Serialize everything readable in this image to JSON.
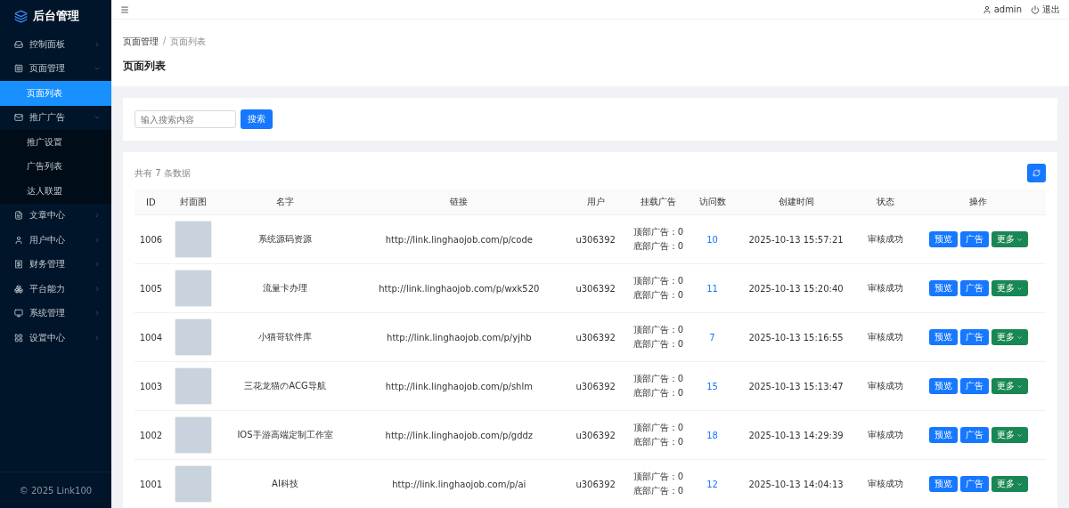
{
  "brand": {
    "title": "后台管理"
  },
  "sidebar": {
    "items": [
      {
        "label": "控制面板",
        "expanded": false
      },
      {
        "label": "页面管理",
        "expanded": true,
        "children": [
          {
            "label": "页面列表",
            "selected": true
          }
        ]
      },
      {
        "label": "推广广告",
        "expanded": true,
        "children": [
          {
            "label": "推广设置",
            "selected": false
          },
          {
            "label": "广告列表",
            "selected": false
          },
          {
            "label": "达人联盟",
            "selected": false
          }
        ]
      },
      {
        "label": "文章中心",
        "expanded": false
      },
      {
        "label": "用户中心",
        "expanded": false
      },
      {
        "label": "财务管理",
        "expanded": false
      },
      {
        "label": "平台能力",
        "expanded": false
      },
      {
        "label": "系统管理",
        "expanded": false
      },
      {
        "label": "设置中心",
        "expanded": false
      }
    ],
    "footer": "© 2025 Link100"
  },
  "topbar": {
    "user": "admin",
    "logout": "退出"
  },
  "breadcrumb": [
    "页面管理",
    "页面列表"
  ],
  "breadcrumb_separator": "/",
  "page_title": "页面列表",
  "search": {
    "placeholder": "输入搜索内容",
    "button": "搜索"
  },
  "table": {
    "summary": "共有 7 条数据",
    "columns": [
      "ID",
      "封面图",
      "名字",
      "链接",
      "用户",
      "挂载广告",
      "访问数",
      "创建时间",
      "状态",
      "操作"
    ],
    "rows": [
      {
        "id": "1006",
        "name": "系统源码资源",
        "link": "http://link.linghaojob.com/p/code",
        "user": "u306392",
        "ads": [
          "顶部广告：0",
          "底部广告：0"
        ],
        "visits": "10",
        "created": "2025-10-13 15:57:21",
        "status": "审核成功",
        "actions": [
          "预览",
          "广告",
          "更多"
        ]
      },
      {
        "id": "1005",
        "name": "流量卡办理",
        "link": "http://link.linghaojob.com/p/wxk520",
        "user": "u306392",
        "ads": [
          "顶部广告：0",
          "底部广告：0"
        ],
        "visits": "11",
        "created": "2025-10-13 15:20:40",
        "status": "审核成功",
        "actions": [
          "预览",
          "广告",
          "更多"
        ]
      },
      {
        "id": "1004",
        "name": "小猫哥软件库",
        "link": "http://link.linghaojob.com/p/yjhb",
        "user": "u306392",
        "ads": [
          "顶部广告：0",
          "底部广告：0"
        ],
        "visits": "7",
        "created": "2025-10-13 15:16:55",
        "status": "审核成功",
        "actions": [
          "预览",
          "广告",
          "更多"
        ]
      },
      {
        "id": "1003",
        "name": "三花龙猫のACG导航",
        "link": "http://link.linghaojob.com/p/shlm",
        "user": "u306392",
        "ads": [
          "顶部广告：0",
          "底部广告：0"
        ],
        "visits": "15",
        "created": "2025-10-13 15:13:47",
        "status": "审核成功",
        "actions": [
          "预览",
          "广告",
          "更多"
        ]
      },
      {
        "id": "1002",
        "name": "IOS手游高端定制工作室",
        "link": "http://link.linghaojob.com/p/gddz",
        "user": "u306392",
        "ads": [
          "顶部广告：0",
          "底部广告：0"
        ],
        "visits": "18",
        "created": "2025-10-13 14:29:39",
        "status": "审核成功",
        "actions": [
          "预览",
          "广告",
          "更多"
        ]
      },
      {
        "id": "1001",
        "name": "AI科技",
        "link": "http://link.linghaojob.com/p/ai",
        "user": "u306392",
        "ads": [
          "顶部广告：0",
          "底部广告：0"
        ],
        "visits": "12",
        "created": "2025-10-13 14:04:13",
        "status": "审核成功",
        "actions": [
          "预览",
          "广告",
          "更多"
        ]
      }
    ]
  }
}
